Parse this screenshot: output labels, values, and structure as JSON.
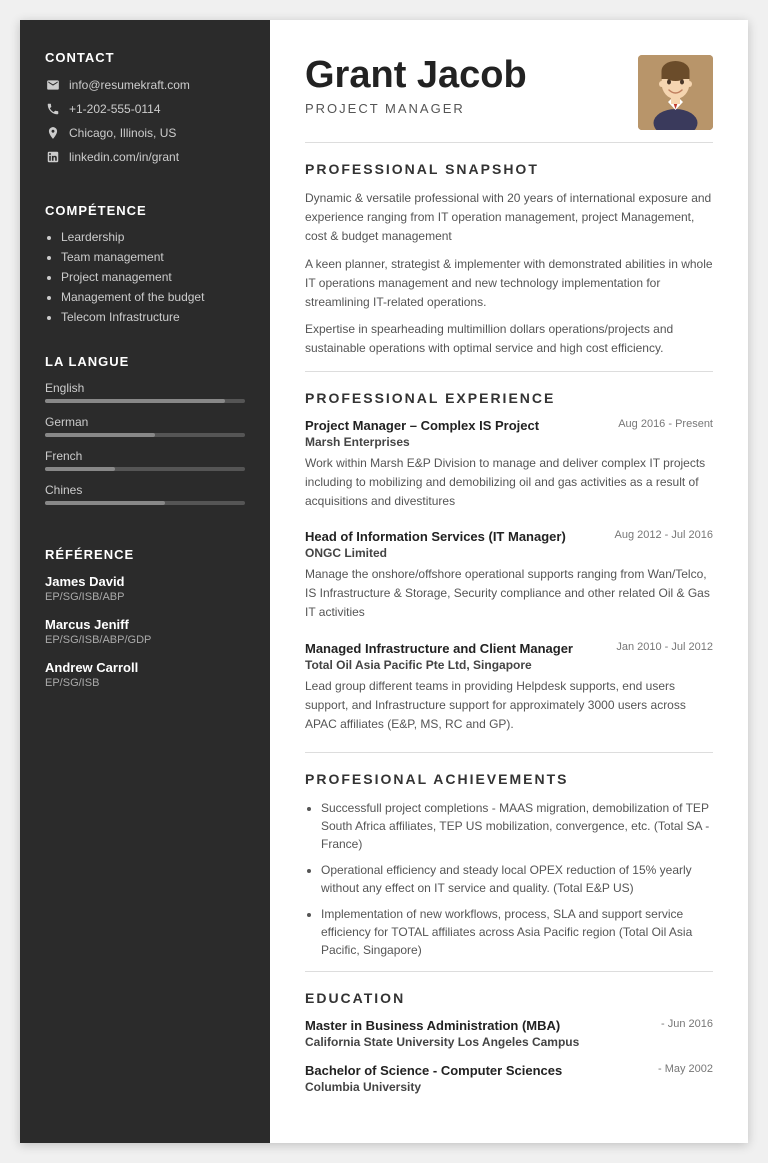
{
  "sidebar": {
    "contact": {
      "title": "CONTACT",
      "email": "info@resumekraft.com",
      "phone": "+1-202-555-0114",
      "location": "Chicago, Illinois, US",
      "linkedin": "linkedin.com/in/grant"
    },
    "competence": {
      "title": "COMPÉTENCE",
      "items": [
        "Leardership",
        "Team management",
        "Project management",
        "Management of the budget",
        "Telecom Infrastructure"
      ]
    },
    "language": {
      "title": "LA LANGUE",
      "items": [
        {
          "name": "English",
          "level": 90
        },
        {
          "name": "German",
          "level": 55
        },
        {
          "name": "French",
          "level": 35
        },
        {
          "name": "Chines",
          "level": 60
        }
      ]
    },
    "reference": {
      "title": "RÉFÉRENCE",
      "items": [
        {
          "name": "James David",
          "detail": "EP/SG/ISB/ABP"
        },
        {
          "name": "Marcus Jeniff",
          "detail": "EP/SG/ISB/ABP/GDP"
        },
        {
          "name": "Andrew Carroll",
          "detail": "EP/SG/ISB"
        }
      ]
    }
  },
  "main": {
    "name": "Grant Jacob",
    "job_title": "PROJECT MANAGER",
    "sections": {
      "snapshot": {
        "title": "PROFESSIONAL SNAPSHOT",
        "paragraphs": [
          "Dynamic & versatile professional with  20 years of international exposure and experience ranging from IT operation management, project Management, cost & budget management",
          "A keen planner, strategist & implementer with demonstrated abilities in whole IT operations management and new technology implementation for streamlining IT-related operations.",
          "Expertise in spearheading multimillion dollars operations/projects and sustainable operations with optimal service and high cost efficiency."
        ]
      },
      "experience": {
        "title": "PROFESSIONAL EXPERIENCE",
        "items": [
          {
            "title": "Project Manager – Complex IS Project",
            "company": "Marsh Enterprises",
            "date": "Aug 2016 - Present",
            "desc": "Work within Marsh E&P Division to manage and deliver complex IT projects including  to mobilizing and demobilizing oil and gas activities as a result of acquisitions and divestitures"
          },
          {
            "title": "Head of Information Services (IT Manager)",
            "company": "ONGC Limited",
            "date": "Aug 2012 - Jul 2016",
            "desc": "Manage the onshore/offshore operational supports ranging from Wan/Telco, IS Infrastructure & Storage, Security compliance and other related Oil & Gas IT activities"
          },
          {
            "title": "Managed Infrastructure and Client Manager",
            "company": "Total Oil Asia Pacific Pte Ltd, Singapore",
            "date": "Jan 2010 - Jul 2012",
            "desc": "Lead group different teams in providing Helpdesk supports, end users support, and Infrastructure support for approximately 3000 users across APAC affiliates (E&P, MS, RC and GP)."
          }
        ]
      },
      "achievements": {
        "title": "PROFESIONAL ACHIEVEMENTS",
        "items": [
          "Successfull project completions - MAAS migration, demobilization of TEP South Africa affiliates, TEP US mobilization, convergence, etc. (Total SA - France)",
          "Operational efficiency and steady local OPEX reduction of 15% yearly without any effect on IT service and quality. (Total E&P US)",
          "Implementation of new workflows, process, SLA and support service efficiency for TOTAL affiliates across Asia Pacific region (Total Oil Asia Pacific, Singapore)"
        ]
      },
      "education": {
        "title": "EDUCATION",
        "items": [
          {
            "degree": "Master in Business Administration (MBA)",
            "school": "California State University Los Angeles Campus",
            "date": "- Jun 2016"
          },
          {
            "degree": "Bachelor of Science - Computer Sciences",
            "school": "Columbia University",
            "date": "- May 2002"
          }
        ]
      }
    }
  }
}
